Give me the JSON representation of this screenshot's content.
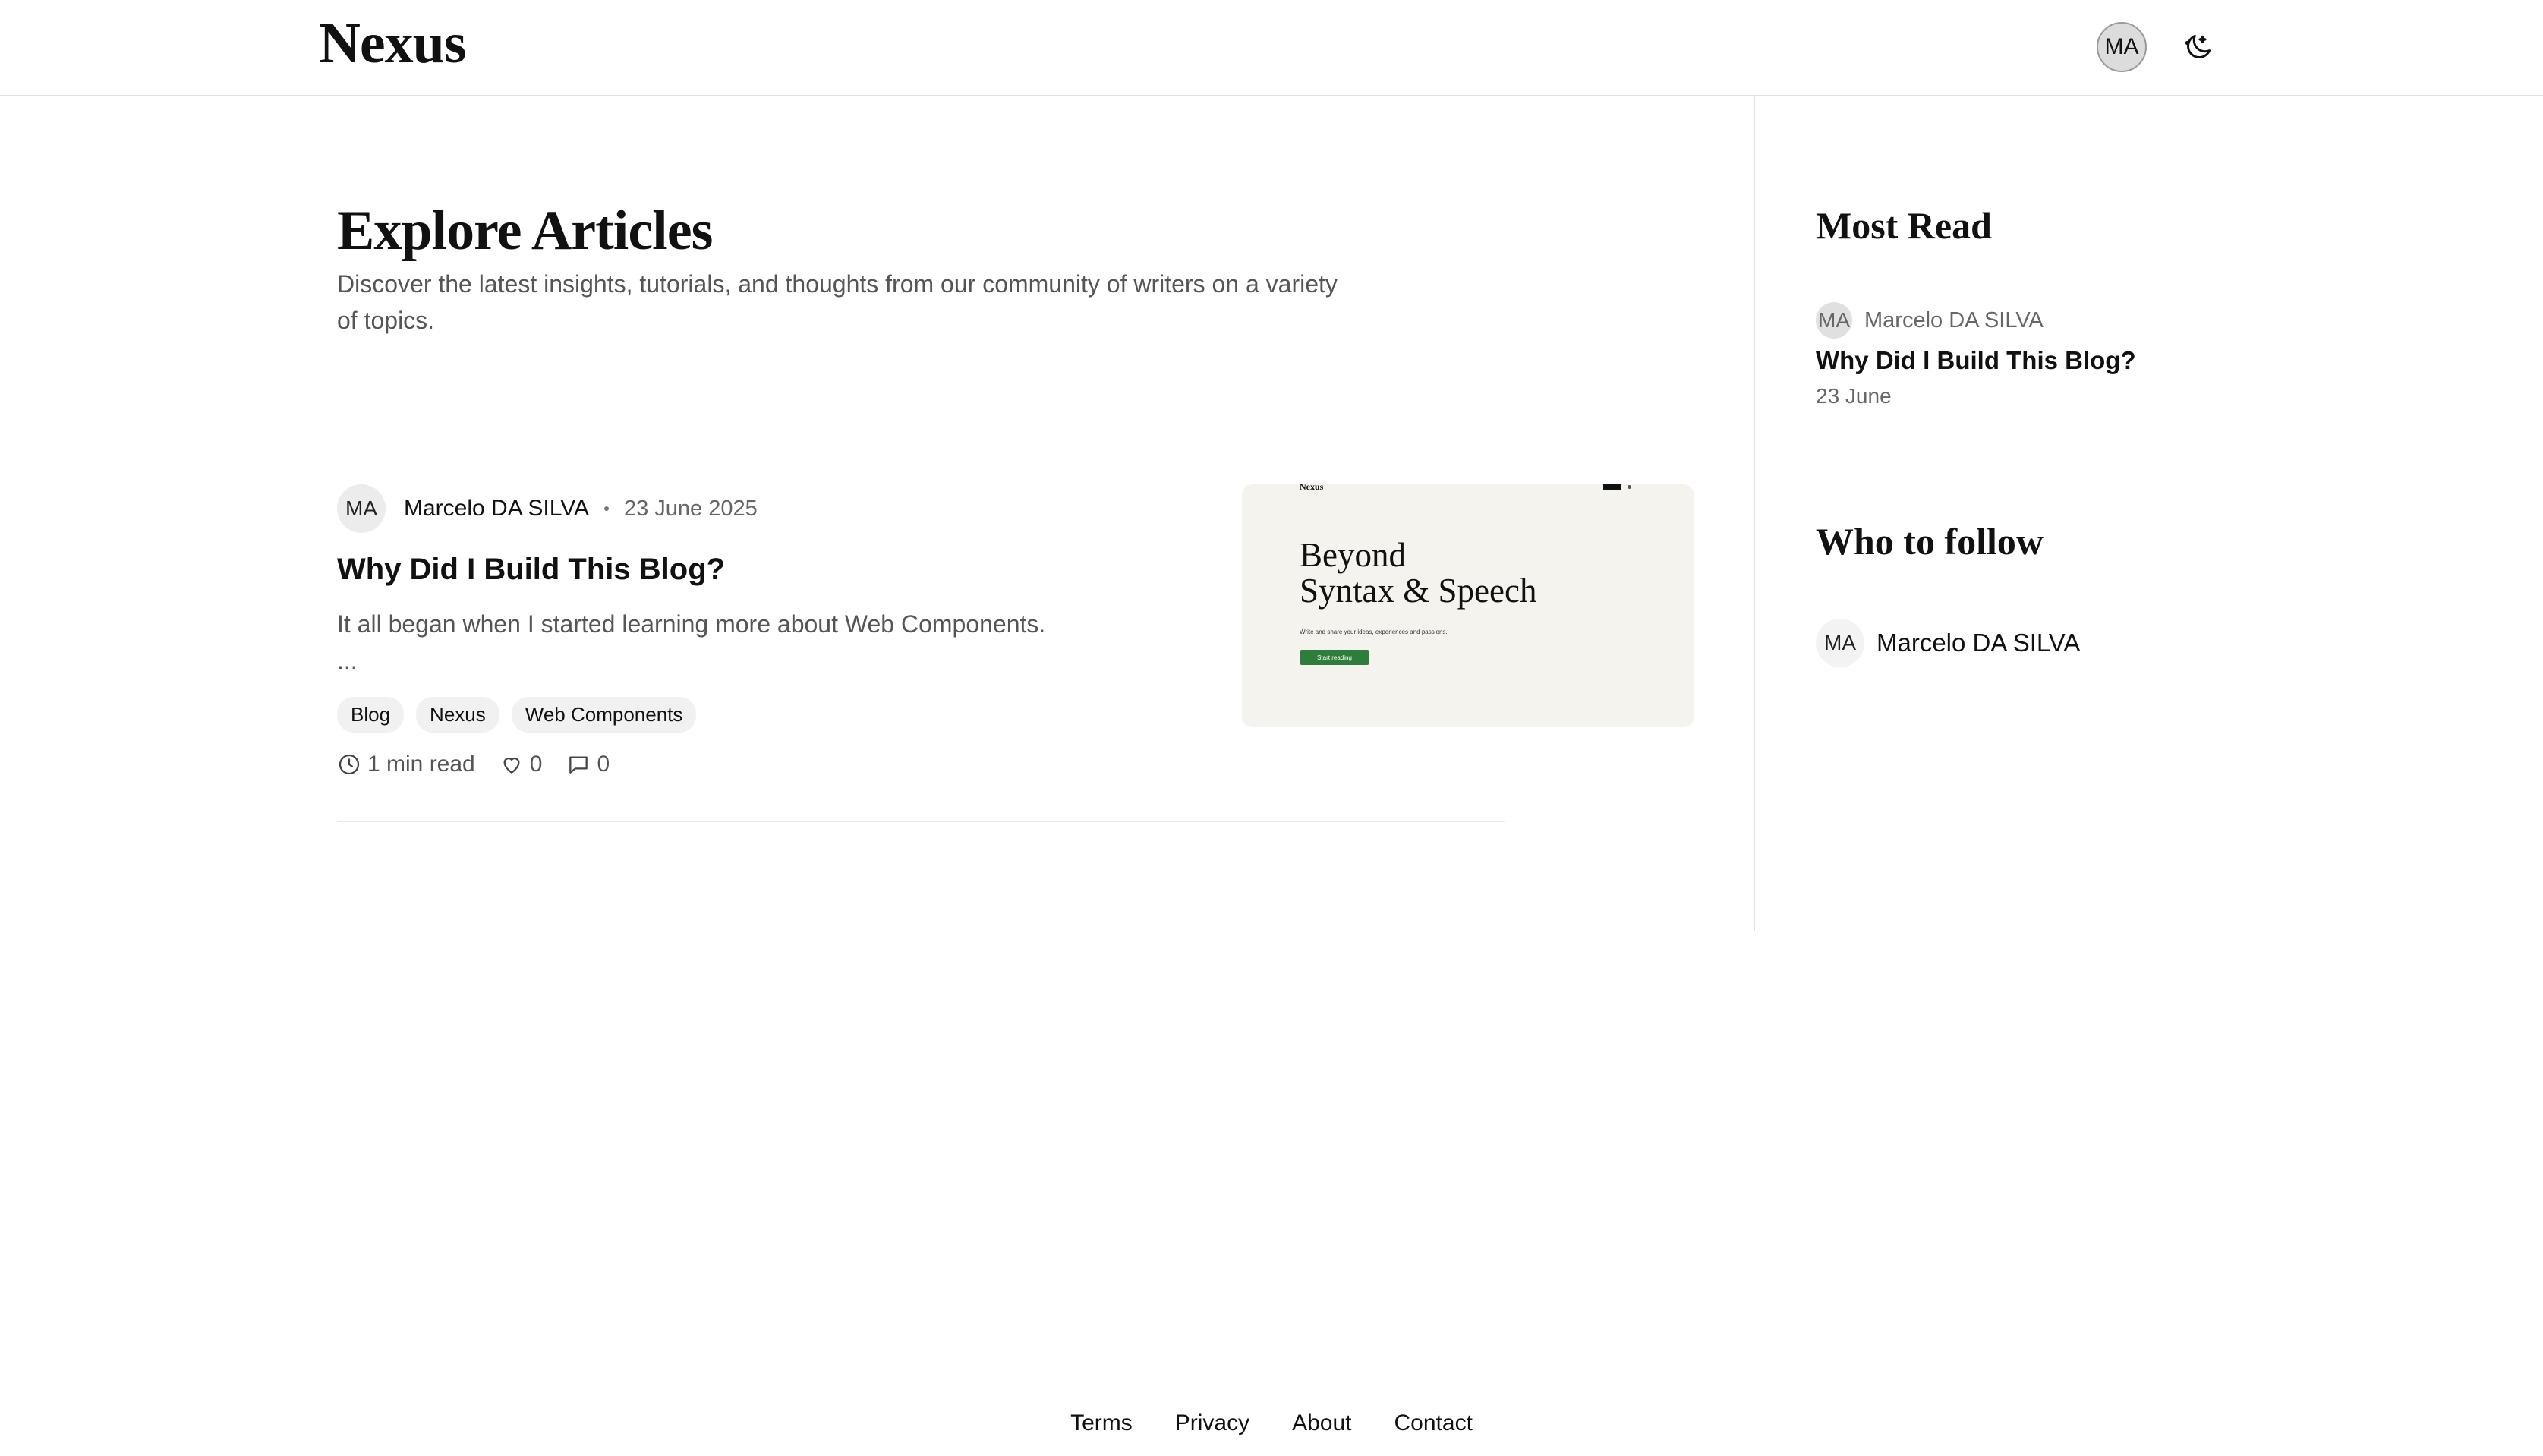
{
  "header": {
    "logo": "Nexus",
    "avatar_initials": "MA",
    "theme_toggle_icon": "moon-stars-icon"
  },
  "main": {
    "title": "Explore Articles",
    "subtitle": "Discover the latest insights, tutorials, and thoughts from our community of writers on a variety of topics."
  },
  "articles": [
    {
      "author_initials": "MA",
      "author_name": "Marcelo DA SILVA",
      "date": "23 June 2025",
      "title": "Why Did I Build This Blog?",
      "excerpt": "It all began when I started learning more about Web Components.",
      "excerpt_ellipsis": "...",
      "tags": [
        "Blog",
        "Nexus",
        "Web Components"
      ],
      "read_time": "1 min read",
      "likes": "0",
      "comments": "0",
      "thumbnail": {
        "logo": "Nexus",
        "heading_line1": "Beyond",
        "heading_line2": "Syntax & Speech",
        "text": "Write and share your ideas, experiences and passions.",
        "button": "Start reading",
        "button_color": "#2f7d3a"
      }
    }
  ],
  "sidebar": {
    "most_read": {
      "title": "Most Read",
      "items": [
        {
          "author_initials": "MA",
          "author_name": "Marcelo DA SILVA",
          "title": "Why Did I Build This Blog?",
          "date": "23 June"
        }
      ]
    },
    "who_to_follow": {
      "title": "Who to follow",
      "items": [
        {
          "initials": "MA",
          "name": "Marcelo DA SILVA"
        }
      ]
    }
  },
  "footer": {
    "links": [
      "Terms",
      "Privacy",
      "About",
      "Contact"
    ]
  }
}
